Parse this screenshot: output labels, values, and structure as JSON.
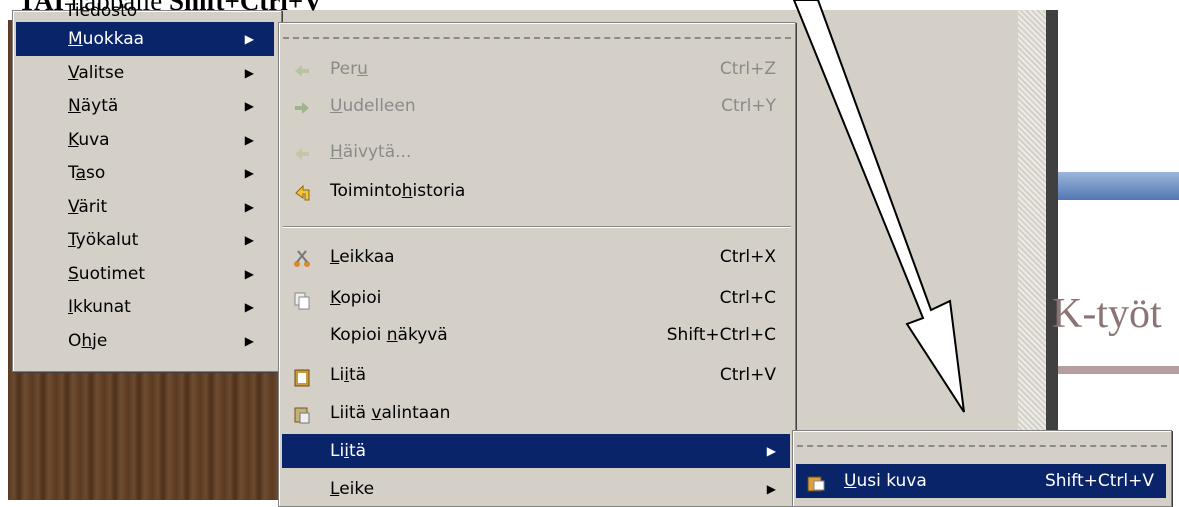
{
  "caption": {
    "bold_start": "TAI",
    "normal": "näppäile",
    "bold_end": "Shift+Ctrl+V"
  },
  "doc": {
    "heading_fragment": "K-työt"
  },
  "menubar": {
    "partial_top": "Tiedosto",
    "items": [
      {
        "label": "Muokkaa",
        "mn": "M",
        "rest": "uokkaa",
        "selected": true
      },
      {
        "label": "Valitse",
        "mn": "V",
        "rest": "alitse"
      },
      {
        "label": "Näytä",
        "mn": "N",
        "rest": "äytä"
      },
      {
        "label": "Kuva",
        "mn": "K",
        "rest": "uva"
      },
      {
        "label": "Taso",
        "pre": "T",
        "mn": "a",
        "rest": "so"
      },
      {
        "label": "Värit",
        "pre": "",
        "mn": "V",
        "rest": "ärit"
      },
      {
        "label": "Työkalut",
        "mn": "T",
        "rest": "yökalut"
      },
      {
        "label": "Suotimet",
        "mn": "S",
        "rest": "uotimet"
      },
      {
        "label": "Ikkunat",
        "mn": "I",
        "rest": "kkunat"
      },
      {
        "label": "Ohje",
        "pre": "O",
        "mn": "h",
        "rest": "je"
      }
    ]
  },
  "edit_menu": {
    "items": [
      {
        "pre": "Per",
        "mn": "u",
        "rest": "",
        "shortcut": "Ctrl+Z",
        "disabled": true,
        "icon": "undo-icon"
      },
      {
        "pre": "",
        "mn": "U",
        "rest": "udelleen",
        "shortcut": "Ctrl+Y",
        "disabled": true,
        "icon": "redo-icon"
      },
      {
        "pre": "",
        "mn": "H",
        "rest": "äivytä...",
        "shortcut": "",
        "disabled": true,
        "icon": "fade-icon"
      },
      {
        "pre": "Toiminto",
        "mn": "h",
        "rest": "istoria",
        "shortcut": "",
        "icon": "history-icon"
      },
      {
        "pre": "",
        "mn": "L",
        "rest": "eikkaa",
        "shortcut": "Ctrl+X",
        "icon": "cut-icon"
      },
      {
        "pre": "",
        "mn": "K",
        "rest": "opioi",
        "shortcut": "Ctrl+C",
        "icon": "copy-icon"
      },
      {
        "pre": "Kopioi ",
        "mn": "n",
        "rest": "äkyvä",
        "shortcut": "Shift+Ctrl+C",
        "icon": ""
      },
      {
        "pre": "Li",
        "mn": "i",
        "rest": "tä",
        "shortcut": "Ctrl+V",
        "icon": "paste-icon"
      },
      {
        "pre": "Liitä ",
        "mn": "v",
        "rest": "alintaan",
        "shortcut": "",
        "icon": "paste-into-icon"
      },
      {
        "pre": "Li",
        "mn": "i",
        "rest": "tä",
        "shortcut": "",
        "selected": true,
        "submenu": true,
        "icon": ""
      },
      {
        "pre": "",
        "mn": "L",
        "rest": "eike",
        "shortcut": "",
        "submenu": true,
        "icon": ""
      }
    ]
  },
  "paste_submenu": {
    "items": [
      {
        "pre": "",
        "mn": "U",
        "rest": "usi kuva",
        "shortcut": "Shift+Ctrl+V",
        "selected": true,
        "icon": "new-image-icon"
      }
    ]
  },
  "colors": {
    "selection": "#0a246a",
    "menu_bg": "#d4d0c8",
    "banner": "#6f92c4"
  }
}
